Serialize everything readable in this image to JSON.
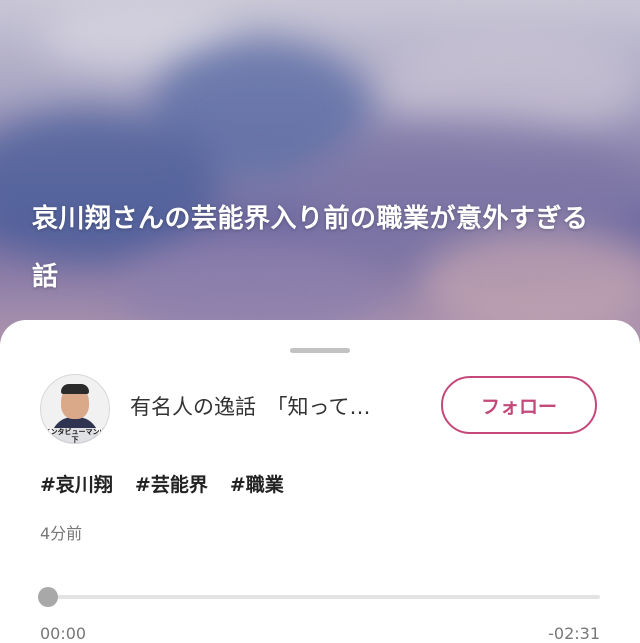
{
  "hero": {
    "title": "哀川翔さんの芸能界入り前の職業が意外すぎる話"
  },
  "channel": {
    "name": "有名人の逸話　「知って…",
    "avatar_caption": "インタビューマン山下",
    "follow_label": "フォロー"
  },
  "tags": [
    "#哀川翔",
    "#芸能界",
    "#職業"
  ],
  "posted": "4分前",
  "player": {
    "elapsed": "00:00",
    "remaining": "-02:31",
    "progress": 0
  },
  "colors": {
    "accent": "#c4487a",
    "secondary_text": "#777777"
  }
}
